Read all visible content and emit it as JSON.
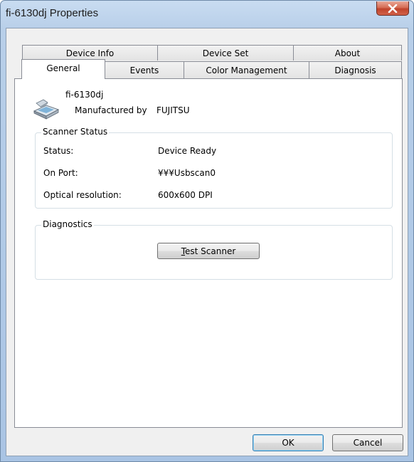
{
  "window": {
    "title": "fi-6130dj Properties"
  },
  "tabs": {
    "back_row": [
      "Device Info",
      "Device Set",
      "About"
    ],
    "front_row": [
      "General",
      "Events",
      "Color Management",
      "Diagnosis"
    ],
    "active": "General"
  },
  "device": {
    "model": "fi-6130dj",
    "manufacturer_label": "Manufactured by",
    "manufacturer_value": "FUJITSU",
    "icon": "scanner-icon"
  },
  "scanner_status": {
    "title": "Scanner Status",
    "rows": [
      {
        "label": "Status:",
        "value": "Device Ready"
      },
      {
        "label": "On Port:",
        "value": "¥¥¥Usbscan0"
      },
      {
        "label": "Optical resolution:",
        "value": "600x600 DPI"
      }
    ]
  },
  "diagnostics": {
    "title": "Diagnostics",
    "test_button": "Test Scanner"
  },
  "footer": {
    "ok_label": "OK",
    "cancel_label": "Cancel"
  },
  "colors": {
    "close_button": "#c7503a",
    "default_button_border": "#3c7fb1"
  }
}
